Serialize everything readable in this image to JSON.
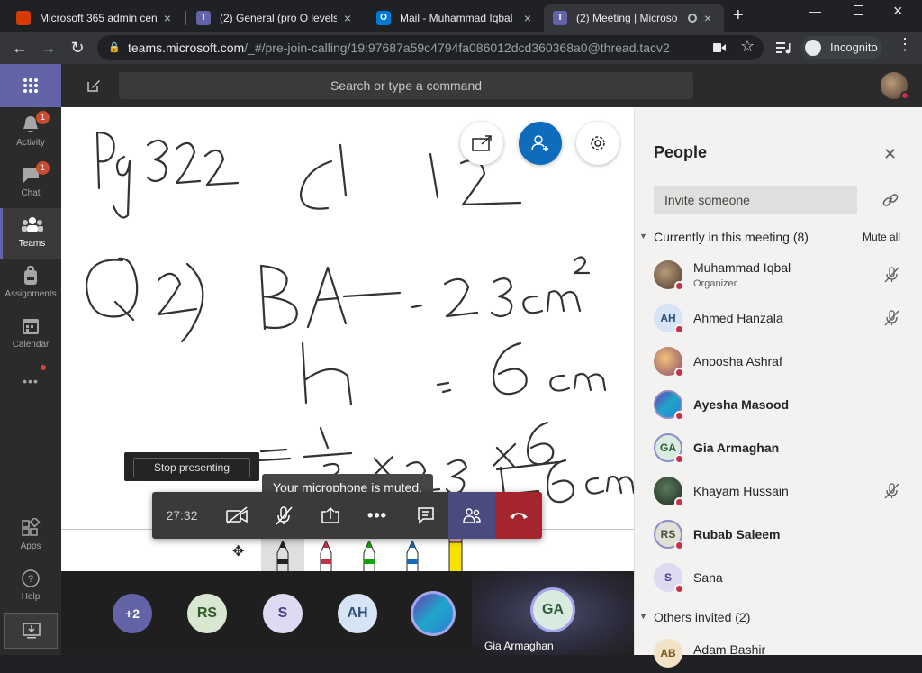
{
  "browser": {
    "tabs": [
      {
        "title": "Microsoft 365 admin cent",
        "icon": "office-icon",
        "color": "#d83b01"
      },
      {
        "title": "(2) General (pro O levels I",
        "icon": "teams-icon",
        "color": "#6264a7"
      },
      {
        "title": "Mail - Muhammad Iqbal",
        "icon": "outlook-icon",
        "color": "#0078d4"
      },
      {
        "title": "(2) Meeting | Microso",
        "icon": "teams-icon",
        "color": "#6264a7"
      }
    ],
    "new_tab": "+",
    "url_host": "teams.microsoft.com",
    "url_path": "/_#/pre-join-calling/19:97687a59c4794fa086012dcd360368a0@thread.tacv2",
    "incognito_label": "Incognito"
  },
  "rail": {
    "items": [
      {
        "label": "Activity",
        "badge": "1",
        "icon": "bell-icon"
      },
      {
        "label": "Chat",
        "badge": "1",
        "icon": "chat-icon"
      },
      {
        "label": "Teams",
        "badge": "",
        "icon": "teams-icon"
      },
      {
        "label": "Assignments",
        "badge": "",
        "icon": "backpack-icon"
      },
      {
        "label": "Calendar",
        "badge": "",
        "icon": "calendar-icon"
      }
    ],
    "more": "•••",
    "apps_label": "Apps",
    "help_label": "Help"
  },
  "header": {
    "search_placeholder": "Search or type a command"
  },
  "whiteboard": {
    "handwriting": [
      "Pg 322",
      "C1",
      "12",
      "Q2)",
      "BA = 23cm²",
      "h = 6cm",
      "= 1/3 × 23 × 6",
      "= 46cm³"
    ]
  },
  "meeting": {
    "stop_presenting": "Stop presenting",
    "muted_tooltip": "Your microphone is muted.",
    "timer": "27:32"
  },
  "strip": {
    "overflow": "+2",
    "avatars": [
      {
        "initials": "RS",
        "bg": "#d9e7d0",
        "fg": "#2d5b2a"
      },
      {
        "initials": "S",
        "bg": "#e0d9f2",
        "fg": "#4b3f8c"
      },
      {
        "initials": "AH",
        "bg": "#d6e4f5",
        "fg": "#2f4f7f"
      }
    ],
    "speaker_initials": "GA",
    "speaker_name": "Gia Armaghan"
  },
  "people": {
    "title": "People",
    "invite_placeholder": "Invite someone",
    "current_label": "Currently in this meeting",
    "current_count": "(8)",
    "mute_all": "Mute all",
    "participants": [
      {
        "name": "Muhammad Iqbal",
        "role": "Organizer",
        "initials": "",
        "bold": false,
        "muted": true
      },
      {
        "name": "Ahmed Hanzala",
        "role": "",
        "initials": "AH",
        "bold": false,
        "muted": true
      },
      {
        "name": "Anoosha Ashraf",
        "role": "",
        "initials": "",
        "bold": false,
        "muted": false
      },
      {
        "name": "Ayesha Masood",
        "role": "",
        "initials": "",
        "bold": true,
        "muted": false
      },
      {
        "name": "Gia Armaghan",
        "role": "",
        "initials": "GA",
        "bold": true,
        "muted": false
      },
      {
        "name": "Khayam Hussain",
        "role": "",
        "initials": "",
        "bold": false,
        "muted": true
      },
      {
        "name": "Rubab Saleem",
        "role": "",
        "initials": "RS",
        "bold": true,
        "muted": false
      },
      {
        "name": "Sana",
        "role": "",
        "initials": "S",
        "bold": false,
        "muted": false
      }
    ],
    "invited_label": "Others invited",
    "invited_count": "(2)",
    "invited": [
      {
        "name": "Adam Bashir",
        "initials": "AB"
      }
    ]
  },
  "colors": {
    "teams_purple": "#6264a7",
    "hangup_red": "#a4262c",
    "busy_red": "#c4314b"
  }
}
